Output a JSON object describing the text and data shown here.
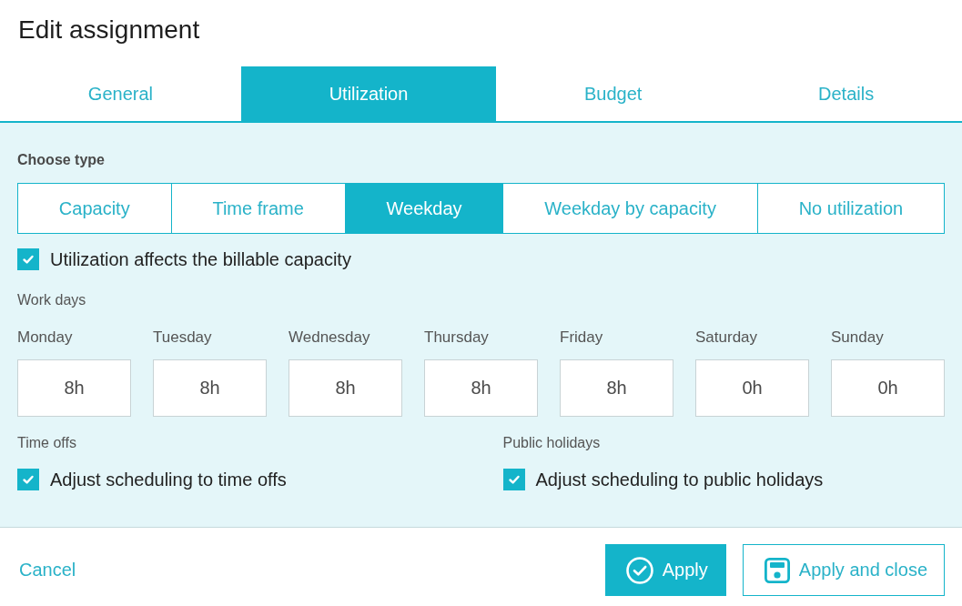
{
  "dialog": {
    "title": "Edit assignment"
  },
  "tabs": [
    {
      "label": "General",
      "selected": false
    },
    {
      "label": "Utilization",
      "selected": true
    },
    {
      "label": "Budget",
      "selected": false
    },
    {
      "label": "Details",
      "selected": false
    }
  ],
  "utilization": {
    "type_label": "Choose type",
    "types": [
      {
        "label": "Capacity",
        "selected": false
      },
      {
        "label": "Time frame",
        "selected": false
      },
      {
        "label": "Weekday",
        "selected": true
      },
      {
        "label": "Weekday by capacity",
        "selected": false
      },
      {
        "label": "No utilization",
        "selected": false
      }
    ],
    "billable_option": {
      "label": "Utilization affects the billable capacity",
      "checked": true
    },
    "work_days": {
      "label": "Work days",
      "days": [
        {
          "name": "Monday",
          "value": "8h"
        },
        {
          "name": "Tuesday",
          "value": "8h"
        },
        {
          "name": "Wednesday",
          "value": "8h"
        },
        {
          "name": "Thursday",
          "value": "8h"
        },
        {
          "name": "Friday",
          "value": "8h"
        },
        {
          "name": "Saturday",
          "value": "0h"
        },
        {
          "name": "Sunday",
          "value": "0h"
        }
      ]
    },
    "sections": [
      {
        "label": "Time offs",
        "option": {
          "label": "Adjust scheduling to time offs",
          "checked": true
        }
      },
      {
        "label": "Public holidays",
        "option": {
          "label": "Adjust scheduling to public holidays",
          "checked": true
        }
      }
    ]
  },
  "footer": {
    "cancel": "Cancel",
    "buttons": [
      {
        "label": "Apply",
        "kind": "primary"
      },
      {
        "label": "Apply and close",
        "kind": "secondary"
      }
    ]
  }
}
